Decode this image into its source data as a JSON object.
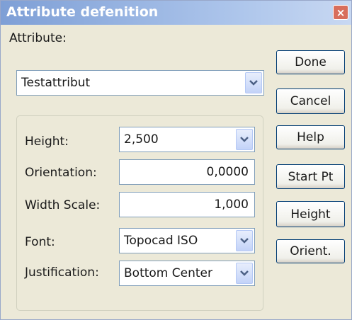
{
  "window": {
    "title": "Attribute defenition",
    "close_glyph": "×"
  },
  "attribute": {
    "label": "Attribute:",
    "value": "Testattribut"
  },
  "fields": {
    "height": {
      "label": "Height:",
      "value": "2,500"
    },
    "orientation": {
      "label": "Orientation:",
      "value": "0,0000"
    },
    "width_scale": {
      "label": "Width Scale:",
      "value": "1,000"
    },
    "font": {
      "label": "Font:",
      "value": "Topocad ISO"
    },
    "justification": {
      "label": "Justification:",
      "value": "Bottom Center"
    }
  },
  "buttons": {
    "done": "Done",
    "cancel": "Cancel",
    "help": "Help",
    "start_pt": "Start Pt",
    "height": "Height",
    "orient": "Orient."
  },
  "icons": {
    "close": "close-icon",
    "dropdown": "chevron-down-icon"
  },
  "colors": {
    "titlebar": "#7E9FD6",
    "dialog_bg": "#ECE9D8",
    "close_button": "#D86E5C"
  }
}
